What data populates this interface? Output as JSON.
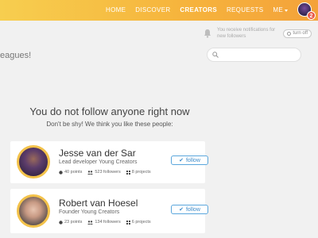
{
  "nav": {
    "items": [
      "HOME",
      "DISCOVER",
      "CREATORS",
      "REQUESTS"
    ],
    "active": "CREATORS",
    "me_label": "ME",
    "notification_count": "2"
  },
  "notifications": {
    "text": "You receive notifications for new followers",
    "toggle_label": "turn off"
  },
  "partial_text": "eagues!",
  "search": {
    "placeholder": ""
  },
  "empty_state": {
    "headline": "You do not follow anyone right now",
    "subline": "Don't be shy! We think you like these people:"
  },
  "suggestions": [
    {
      "name": "Jesse van der Sar",
      "role": "Lead developer Young Creators",
      "points": "40 points",
      "followers": "523 followers",
      "projects": "8 projects",
      "follow_label": "follow"
    },
    {
      "name": "Robert van Hoesel",
      "role": "Founder Young Creators",
      "points": "23 points",
      "followers": "134 followers",
      "projects": "6 projects",
      "follow_label": "follow"
    }
  ],
  "colors": {
    "topbar_start": "#f7ce4f",
    "topbar_end": "#f4a23a",
    "accent_blue": "#3d8ccb",
    "avatar_ring": "#f3c24a",
    "badge": "#e85b4a"
  }
}
